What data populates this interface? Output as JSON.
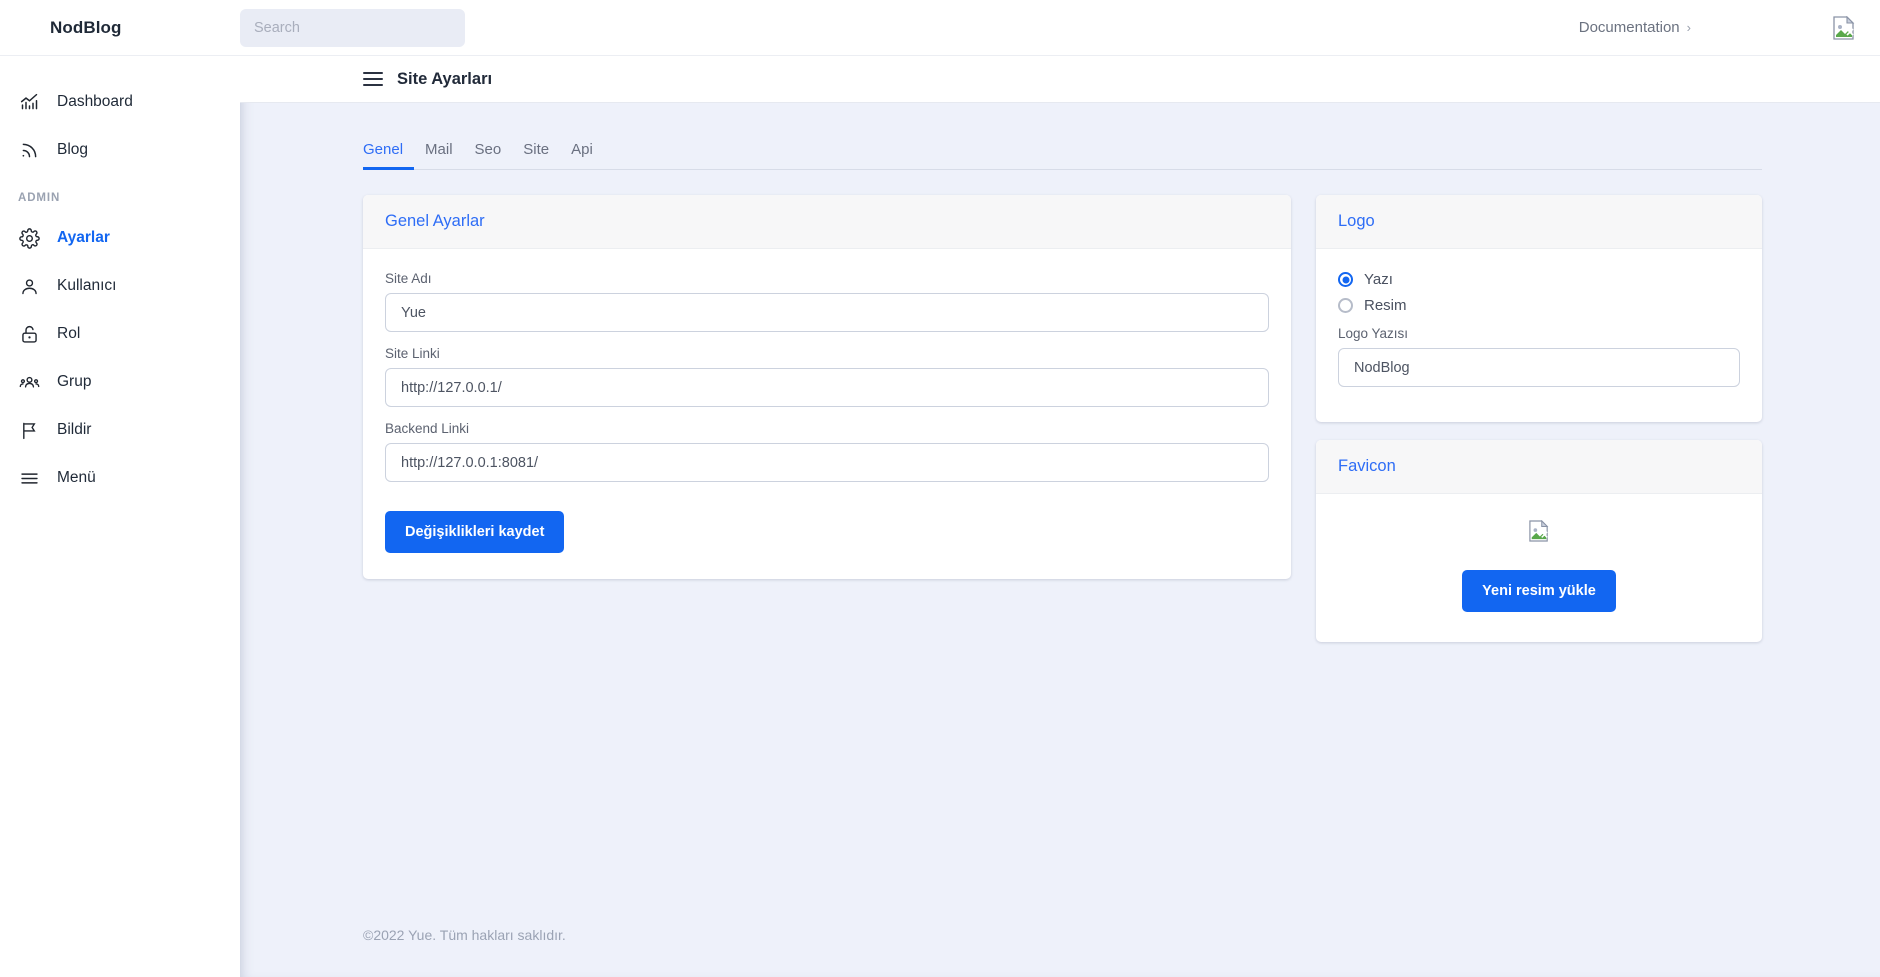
{
  "topbar": {
    "brand": "NodBlog",
    "search_placeholder": "Search",
    "search_value": "",
    "doc_link": "Documentation",
    "doc_chevron": "›",
    "avatar_alt": "broken-image"
  },
  "sidebar": {
    "items": [
      {
        "label": "Dashboard",
        "icon": "chart-line-icon",
        "active": false
      },
      {
        "label": "Blog",
        "icon": "rss-icon",
        "active": false
      }
    ],
    "section_label": "ADMIN",
    "admin_items": [
      {
        "label": "Ayarlar",
        "icon": "gear-icon",
        "active": true
      },
      {
        "label": "Kullanıcı",
        "icon": "user-icon",
        "active": false
      },
      {
        "label": "Rol",
        "icon": "lock-icon",
        "active": false
      },
      {
        "label": "Grup",
        "icon": "group-icon",
        "active": false
      },
      {
        "label": "Bildir",
        "icon": "flag-icon",
        "active": false
      },
      {
        "label": "Menü",
        "icon": "menu-icon",
        "active": false
      }
    ]
  },
  "page": {
    "title": "Site Ayarları",
    "tabs": [
      {
        "label": "Genel",
        "active": true
      },
      {
        "label": "Mail",
        "active": false
      },
      {
        "label": "Seo",
        "active": false
      },
      {
        "label": "Site",
        "active": false
      },
      {
        "label": "Api",
        "active": false
      }
    ]
  },
  "general_settings": {
    "card_title": "Genel Ayarlar",
    "fields": [
      {
        "label": "Site Adı",
        "value": "Yue"
      },
      {
        "label": "Site Linki",
        "value": "http://127.0.0.1/"
      },
      {
        "label": "Backend Linki",
        "value": "http://127.0.0.1:8081/"
      }
    ],
    "save_label": "Değişiklikleri kaydet"
  },
  "logo": {
    "card_title": "Logo",
    "options": [
      {
        "label": "Yazı",
        "selected": true
      },
      {
        "label": "Resim",
        "selected": false
      }
    ],
    "text_label": "Logo Yazısı",
    "text_value": "NodBlog"
  },
  "favicon": {
    "card_title": "Favicon",
    "image_alt": "broken-image",
    "upload_label": "Yeni resim yükle"
  },
  "footer": {
    "text": "©2022 Yue. Tüm hakları saklıdır."
  },
  "colors": {
    "accent": "#1266f1",
    "tab_active": "#2e6df6",
    "content_bg": "#eef1fa",
    "search_bg": "#e9ecf5"
  }
}
